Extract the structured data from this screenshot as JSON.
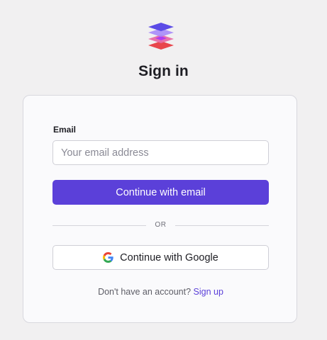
{
  "logo": {
    "icon": "stacked-layers-logo-icon",
    "colors": [
      "#5b4be6",
      "#9b5cf6",
      "#e85a8a",
      "#e84a4a"
    ]
  },
  "page": {
    "title": "Sign in"
  },
  "form": {
    "email_label": "Email",
    "email_value": "",
    "email_placeholder": "Your email address",
    "submit_label": "Continue with email",
    "divider_text": "OR",
    "google_label": "Continue with Google",
    "google_icon": "google-g-icon"
  },
  "footer": {
    "prompt": "Don't have an account?",
    "signup_link": "Sign up"
  },
  "colors": {
    "accent": "#5b40d9",
    "background": "#f1f0f1",
    "card": "#fafafc"
  }
}
